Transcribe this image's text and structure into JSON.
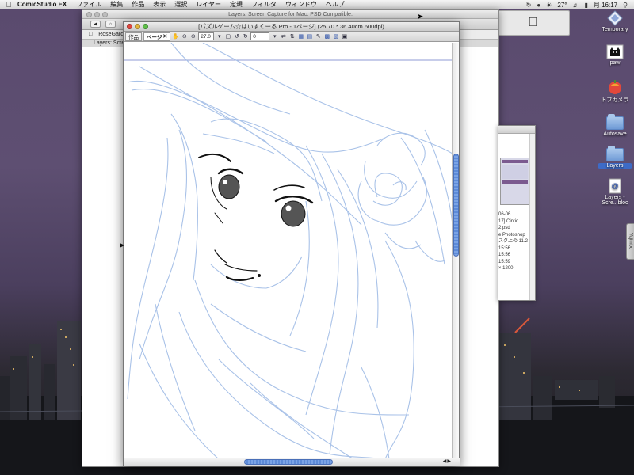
{
  "menubar": {
    "app_name": "ComicStudio EX",
    "items": [
      "ファイル",
      "編集",
      "作品",
      "表示",
      "選択",
      "レイヤー",
      "定規",
      "フィルタ",
      "ウィンドウ",
      "ヘルプ"
    ],
    "temperature": "27°",
    "clock": "月 16:17"
  },
  "bg_window": {
    "title": "Layers: Screen Capture for Mac. PSD Compatible.",
    "bookmark": "RoseGarde",
    "tab_label": "Layers: Scre"
  },
  "main_window": {
    "title": "[パズルゲーム☆はいすくーる Pro - 1ページ] (25.70 * 36.40cm 600dpi)",
    "tabs": [
      {
        "label": "作品"
      },
      {
        "label": "ページ"
      }
    ],
    "zoom_value": "27.0",
    "rotation_value": "0"
  },
  "side_window": {
    "lines": [
      "06-06",
      "17] Cintiq",
      "2.psd",
      "e Photoshop",
      "",
      "スク上の 11.2",
      "",
      "15:56",
      "15:56",
      "15:59",
      "× 1200"
    ]
  },
  "desktop_icons": [
    {
      "label": "Temporary",
      "icon": "diamond-icon"
    },
    {
      "label": "paw",
      "icon": "cat-icon"
    },
    {
      "label": "トブカメラ",
      "icon": "apple-icon"
    },
    {
      "label": "Autosave",
      "icon": "folder-icon"
    },
    {
      "label": "Layers",
      "icon": "folder-icon"
    },
    {
      "label": "Layers - Scre...bloc",
      "icon": "document-icon"
    }
  ],
  "yojimbo_label": "Yojimbo"
}
